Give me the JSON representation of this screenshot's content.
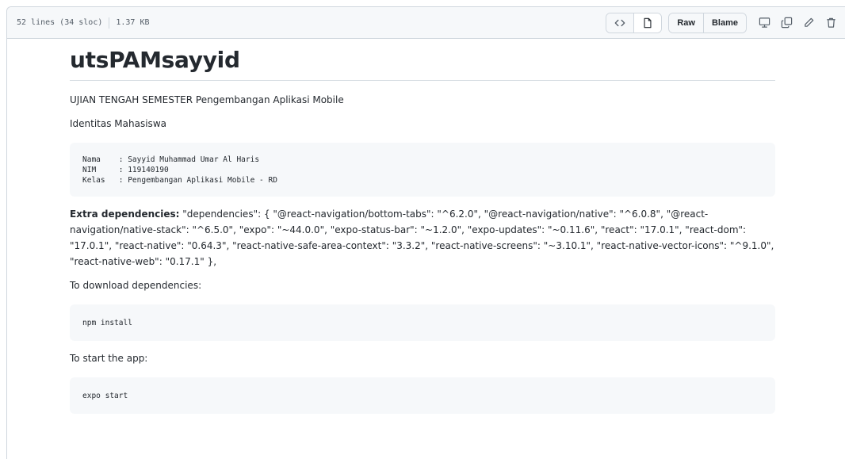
{
  "file_header": {
    "lines_info": "52 lines (34 sloc)",
    "size": "1.37 KB",
    "raw_label": "Raw",
    "blame_label": "Blame",
    "icons": [
      "code-icon",
      "file-icon",
      "desktop-icon",
      "copy-icon",
      "pencil-icon",
      "trash-icon"
    ]
  },
  "readme": {
    "title": "utsPAMsayyid",
    "subtitle": "UJIAN TENGAH SEMESTER Pengembangan Aplikasi Mobile",
    "identity_heading": "Identitas Mahasiswa",
    "identity_lines": [
      "Nama    : Sayyid Muhammad Umar Al Haris",
      "NIM     : 119140190",
      "Kelas   : Pengembangan Aplikasi Mobile - RD"
    ],
    "extra_label": "Extra dependencies:",
    "extra_text": " \"dependencies\": { \"@react-navigation/bottom-tabs\": \"^6.2.0\", \"@react-navigation/native\": \"^6.0.8\", \"@react-navigation/native-stack\": \"^6.5.0\", \"expo\": \"~44.0.0\", \"expo-status-bar\": \"~1.2.0\", \"expo-updates\": \"~0.11.6\", \"react\": \"17.0.1\", \"react-dom\": \"17.0.1\", \"react-native\": \"0.64.3\", \"react-native-safe-area-context\": \"3.3.2\", \"react-native-screens\": \"~3.10.1\", \"react-native-vector-icons\": \"^9.1.0\", \"react-native-web\": \"0.17.1\" },",
    "download_text": "To download dependencies:",
    "install_cmd": "npm install",
    "start_text": "To start the app:",
    "start_cmd": "expo start"
  },
  "colors": {
    "border": "#d0d7de",
    "header_bg": "#f6f8fa",
    "code_bg": "#f6f8fa",
    "text": "#24292f",
    "muted": "#57606a"
  }
}
